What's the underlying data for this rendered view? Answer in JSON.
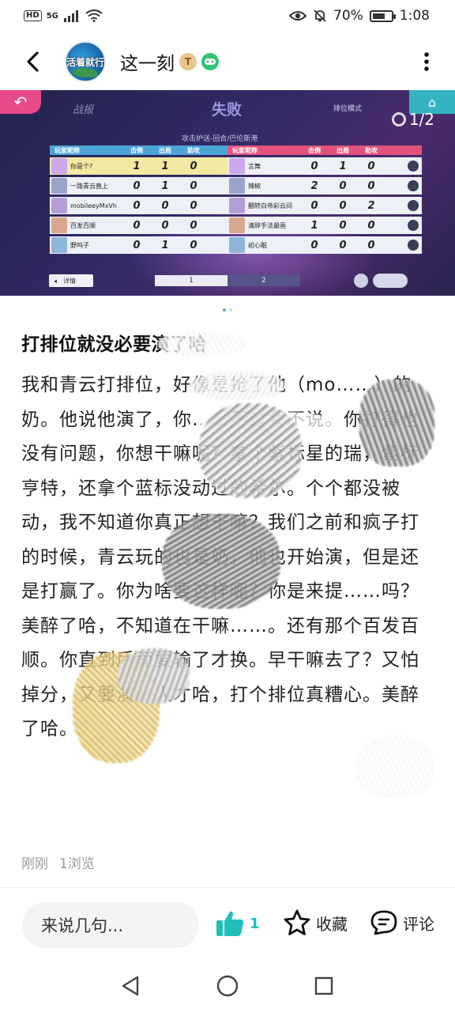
{
  "status_bar": {
    "hd": "HD",
    "signal": "5G",
    "battery_pct": "70%",
    "battery_level": 0.7,
    "time": "1:08"
  },
  "header": {
    "back_icon": "chevron-left-icon",
    "avatar_text": "活着就行",
    "title": "这一刻",
    "badge1_text": "T",
    "more_icon": "vertical-dots-icon"
  },
  "game": {
    "report_label": "战报",
    "result_label": "失败",
    "mode_label": "排位模式",
    "map_line": "攻击护送-回合/巴伦斯港",
    "counter": "1/2",
    "headers": {
      "left_name": "玩家昵称",
      "right_name": "玩家昵称",
      "kills": "击倒",
      "deaths": "出局",
      "assists": "助攻"
    },
    "left_team": [
      {
        "name": "你是个?",
        "k": "1",
        "d": "1",
        "a": "0"
      },
      {
        "name": "一路青云直上",
        "k": "0",
        "d": "1",
        "a": "0"
      },
      {
        "name": "mobileeyMxVh",
        "k": "0",
        "d": "0",
        "a": "0"
      },
      {
        "name": "百发百顺",
        "k": "0",
        "d": "0",
        "a": "0"
      },
      {
        "name": "野呜子",
        "k": "0",
        "d": "1",
        "a": "0"
      }
    ],
    "right_team": [
      {
        "name": "言舞",
        "k": "0",
        "d": "1",
        "a": "0"
      },
      {
        "name": "辣椒",
        "k": "2",
        "d": "0",
        "a": "0"
      },
      {
        "name": "翻转白帝彩云间",
        "k": "0",
        "d": "0",
        "a": "2"
      },
      {
        "name": "清辞手法最画",
        "k": "1",
        "d": "0",
        "a": "0"
      },
      {
        "name": "初心眠",
        "k": "0",
        "d": "0",
        "a": "0"
      }
    ],
    "detail_label": "详情",
    "page1": "1",
    "page2": "2"
  },
  "post": {
    "title": "打排位就没必要演了哈",
    "body": "我和青云打排位，好像是抢了他（mo……）的奶。他说他演了，你……不过我不说。你打得也没有问题，你想干嘛呢？拿个紫标星的瑞，紫标亨特，还拿个蓝标没动过的希尔。个个都没被动，我不知道你真正想干嘛？我们之前和疯子打的时候，青云玩的也是奶，他也开始演，但是还是打赢了。你为啥要这样呢？你是来提……吗？美醉了哈，不知道在干嘛……。还有那个百发百顺。你直到后面要输了才换。早干嘛去了？又怕掉分，又要演。人才哈，打个排位真糟心。美醉了哈。",
    "time": "刚刚",
    "views": "1浏览"
  },
  "actions": {
    "comment_placeholder": "来说几句...",
    "like_count": "1",
    "favorite_label": "收藏",
    "comment_label": "评论",
    "accent": "#1fbfb8"
  },
  "nav": {
    "back": "triangle-back-icon",
    "home": "circle-home-icon",
    "recent": "square-recent-icon"
  }
}
